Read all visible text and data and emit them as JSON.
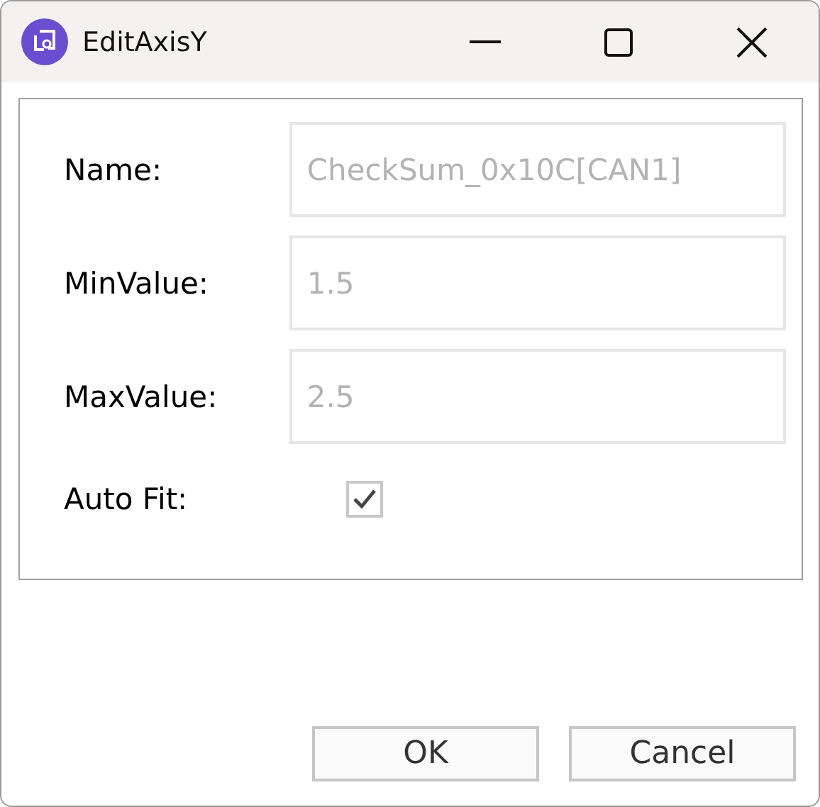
{
  "window": {
    "title": "EditAxisY"
  },
  "fields": [
    {
      "label": "Name:",
      "value": "CheckSum_0x10C[CAN1]",
      "disabled": true
    },
    {
      "label": "MinValue:",
      "value": "1.5",
      "disabled": true
    },
    {
      "label": "MaxValue:",
      "value": "2.5",
      "disabled": true
    }
  ],
  "auto_fit": {
    "label": "Auto Fit:",
    "checked": true
  },
  "buttons": [
    "OK",
    "Cancel"
  ]
}
